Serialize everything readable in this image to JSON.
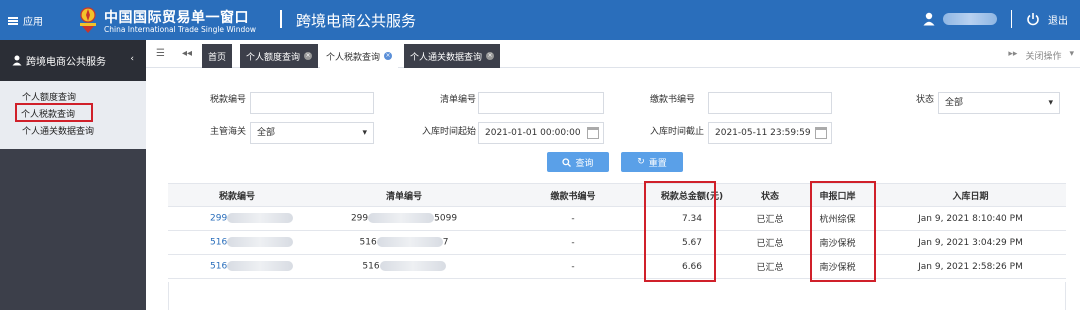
{
  "header": {
    "menu_label": "应用",
    "brand_cn": "中国国际贸易单一窗口",
    "brand_en": "China International Trade Single Window",
    "app_title": "跨境电商公共服务",
    "logout_label": "退出"
  },
  "sidebar": {
    "title": "跨境电商公共服务",
    "items": [
      {
        "label": "个人额度查询"
      },
      {
        "label": "个人税款查询"
      },
      {
        "label": "个人通关数据查询"
      }
    ]
  },
  "tabs": {
    "home": "首页",
    "items": [
      {
        "label": "个人额度查询"
      },
      {
        "label": "个人税款查询"
      },
      {
        "label": "个人通关数据查询"
      }
    ],
    "close_ops": "关闭操作"
  },
  "filters": {
    "tax_no_label": "税款编号",
    "list_no_label": "清单编号",
    "bill_no_label": "缴款书编号",
    "status_label": "状态",
    "status_value": "全部",
    "customs_label": "主管海关",
    "customs_value": "全部",
    "start_label": "入库时间起始",
    "start_value": "2021-01-01 00:00:00",
    "end_label": "入库时间截止",
    "end_value": "2021-05-11 23:59:59",
    "query_button": "查询",
    "reset_button": "重置"
  },
  "table": {
    "headers": [
      "税款编号",
      "清单编号",
      "缴款书编号",
      "税款总金额(元)",
      "状态",
      "申报口岸",
      "入库日期"
    ],
    "rows": [
      {
        "tax_no": "299",
        "list_no": "299",
        "list_tail": "5099",
        "bill_no": "-",
        "amount": "7.34",
        "status": "已汇总",
        "port": "杭州综保",
        "date": "Jan 9, 2021 8:10:40 PM"
      },
      {
        "tax_no": "516",
        "list_no": "516",
        "list_tail": "7",
        "bill_no": "-",
        "amount": "5.67",
        "status": "已汇总",
        "port": "南沙保税",
        "date": "Jan 9, 2021 3:04:29 PM"
      },
      {
        "tax_no": "516",
        "list_no": "516",
        "list_tail": "",
        "bill_no": "-",
        "amount": "6.66",
        "status": "已汇总",
        "port": "南沙保税",
        "date": "Jan 9, 2021 2:58:26 PM"
      }
    ]
  },
  "colors": {
    "header_blue": "#2a6ebb",
    "sidebar_dark": "#3c3f4a",
    "highlight_red": "#d0202a",
    "button_blue": "#5aa0e8"
  }
}
